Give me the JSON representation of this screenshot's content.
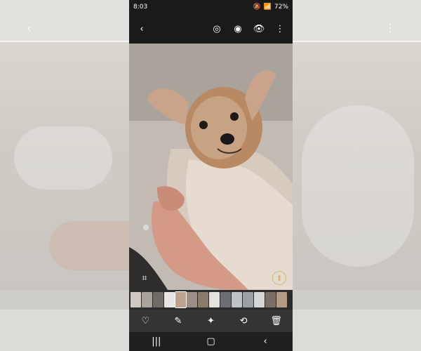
{
  "status_bar": {
    "time": "8:03",
    "battery": "72%"
  },
  "app_bar": {
    "icons": [
      "back-icon",
      "play-icon",
      "bixby-vision-icon",
      "eye-icon",
      "more-icon"
    ]
  },
  "photo": {
    "subject": "Yorkshire terrier"
  },
  "bottom_actions": {
    "icons": [
      "heart-icon",
      "pencil-icon",
      "sparkle-icon",
      "share-icon",
      "trash-icon"
    ]
  },
  "nav_bar": {
    "icons": [
      "recents-icon",
      "home-icon",
      "back-nav-icon"
    ]
  },
  "thumbnails": {
    "count": 14,
    "colors": [
      "#cfc9c2",
      "#a9a39c",
      "#6f6b66",
      "#e8e6e4",
      "#bda38f",
      "#9b8e86",
      "#8a7a68",
      "#e4e2df",
      "#6c6e72",
      "#bfc3c7",
      "#9aa0a6",
      "#d5d6d8",
      "#7a6e66",
      "#b59a86"
    ],
    "selected_index": 4
  },
  "colors": {
    "overlay": "#000000",
    "nav_bar": "#1f1f1f",
    "strip": "#2b2b2b"
  }
}
